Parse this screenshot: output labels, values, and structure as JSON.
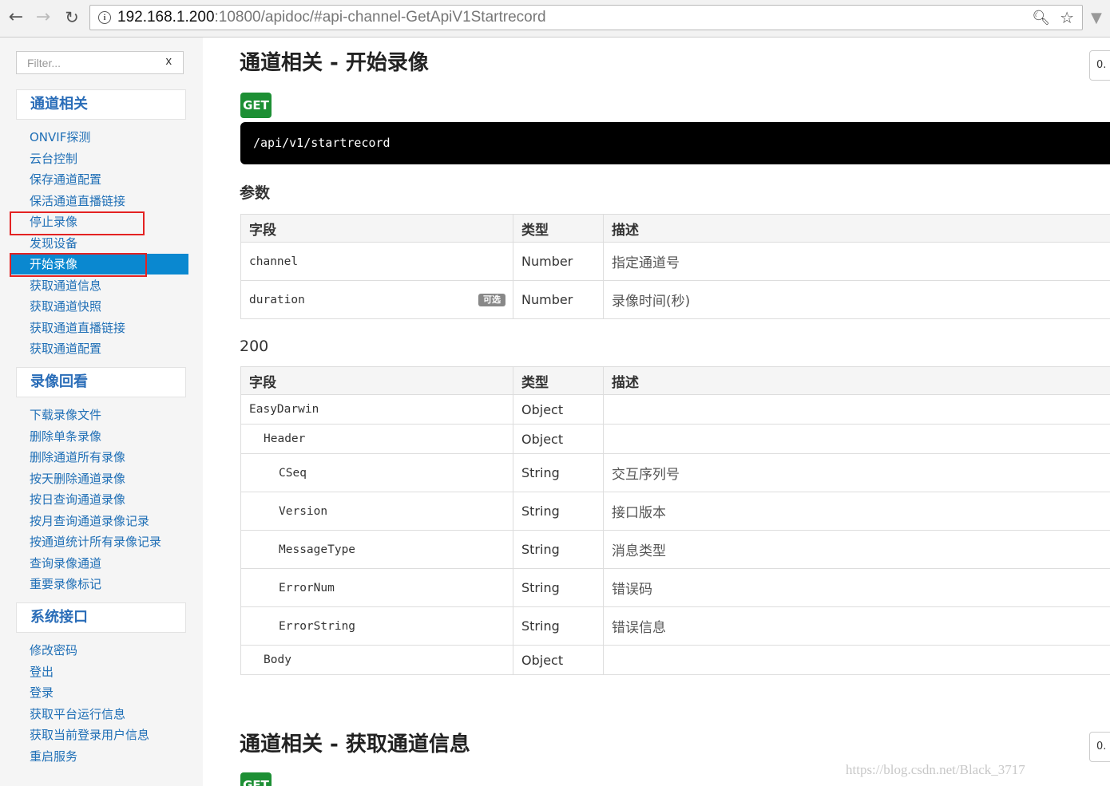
{
  "browser": {
    "url_host": "192.168.1.200",
    "url_rest": ":10800/apidoc/#api-channel-GetApiV1Startrecord"
  },
  "sidebar": {
    "filter_placeholder": "Filter...",
    "filter_clear": "x",
    "groups": [
      {
        "header": "通道相关",
        "items": [
          "ONVIF探测",
          "云台控制",
          "保存通道配置",
          "保活通道直播链接",
          "停止录像",
          "发现设备",
          "开始录像",
          "获取通道信息",
          "获取通道快照",
          "获取通道直播链接",
          "获取通道配置"
        ],
        "active_index": 6
      },
      {
        "header": "录像回看",
        "items": [
          "下载录像文件",
          "删除单条录像",
          "删除通道所有录像",
          "按天删除通道录像",
          "按日查询通道录像",
          "按月查询通道录像记录",
          "按通道统计所有录像记录",
          "查询录像通道",
          "重要录像标记"
        ]
      },
      {
        "header": "系统接口",
        "items": [
          "修改密码",
          "登出",
          "登录",
          "获取平台运行信息",
          "获取当前登录用户信息",
          "重启服务"
        ]
      }
    ]
  },
  "main": {
    "title": "通道相关 - 开始录像",
    "version_label": "0.",
    "method": "GET",
    "endpoint": "/api/v1/startrecord",
    "params_heading": "参数",
    "table_headers": [
      "字段",
      "类型",
      "描述"
    ],
    "params_rows": [
      {
        "field": "channel",
        "optional": "",
        "type": "Number",
        "desc": "指定通道号"
      },
      {
        "field": "duration",
        "optional": "可选",
        "type": "Number",
        "desc": "录像时间(秒)"
      }
    ],
    "response_heading": "200",
    "response_rows": [
      {
        "field": "EasyDarwin",
        "type": "Object",
        "desc": ""
      },
      {
        "field": "Header",
        "type": "Object",
        "desc": ""
      },
      {
        "field": "CSeq",
        "type": "String",
        "desc": "交互序列号"
      },
      {
        "field": "Version",
        "type": "String",
        "desc": "接口版本"
      },
      {
        "field": "MessageType",
        "type": "String",
        "desc": "消息类型"
      },
      {
        "field": "ErrorNum",
        "type": "String",
        "desc": "错误码"
      },
      {
        "field": "ErrorString",
        "type": "String",
        "desc": "错误信息"
      },
      {
        "field": "Body",
        "type": "Object",
        "desc": ""
      }
    ],
    "next_title": "通道相关 - 获取通道信息",
    "next_method": "GET",
    "next_version_label": "0."
  },
  "watermark": "https://blog.csdn.net/Black_3717",
  "colors": {
    "accent": "#0a88d0",
    "link": "#1f6fb6",
    "get_badge": "#1d8f34",
    "highlight_box": "#e32222"
  }
}
